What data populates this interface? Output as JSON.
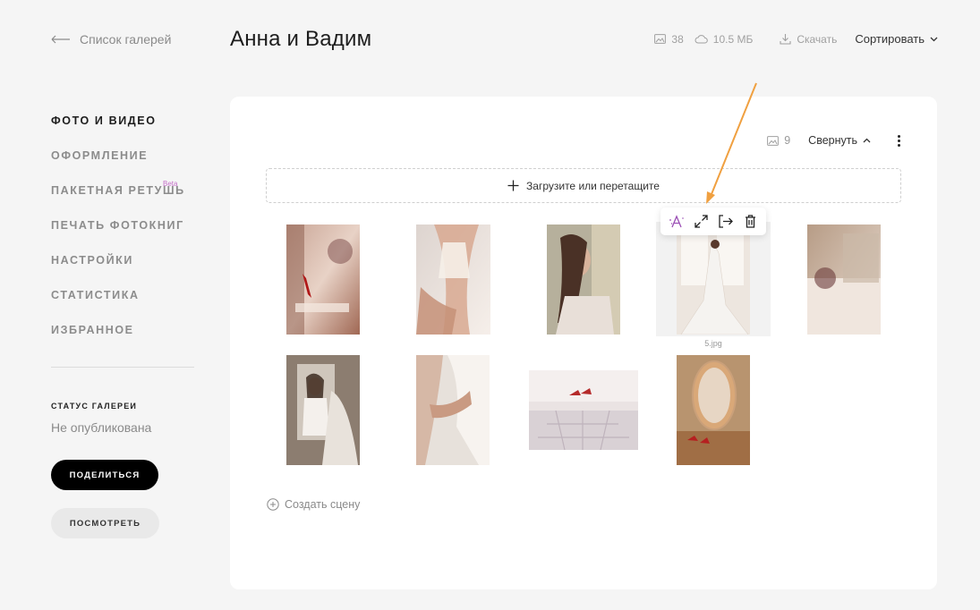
{
  "header": {
    "back_label": "Список галерей",
    "title": "Анна и Вадим",
    "photo_count": "38",
    "size": "10.5 МБ",
    "download_label": "Скачать",
    "sort_label": "Сортировать"
  },
  "sidebar": {
    "items": [
      {
        "label": "ФОТО И ВИДЕО",
        "active": true
      },
      {
        "label": "ОФОРМЛЕНИЕ",
        "active": false
      },
      {
        "label": "ПАКЕТНАЯ РЕТУШЬ",
        "active": false,
        "badge": "Beta"
      },
      {
        "label": "ПЕЧАТЬ ФОТОКНИГ",
        "active": false
      },
      {
        "label": "НАСТРОЙКИ",
        "active": false
      },
      {
        "label": "СТАТИСТИКА",
        "active": false
      },
      {
        "label": "ИЗБРАННОЕ",
        "active": false
      }
    ],
    "status_label": "СТАТУС ГАЛЕРЕИ",
    "status_value": "Не опубликована",
    "share_label": "ПОДЕЛИТЬСЯ",
    "view_label": "ПОСМОТРЕТЬ"
  },
  "scene": {
    "photo_count": "9",
    "collapse_label": "Свернуть",
    "upload_label": "Загрузите или перетащите",
    "selected_filename": "5.jpg",
    "create_scene_label": "Создать сцену"
  },
  "colors": {
    "accent_purple": "#c56fc9",
    "annotation_arrow": "#f0a040",
    "primary_button": "#000000"
  },
  "icons": [
    "arrow-left-icon",
    "image-icon",
    "cloud-icon",
    "download-icon",
    "chevron-down-icon",
    "chevron-up-icon",
    "more-vertical-icon",
    "plus-icon",
    "retouch-icon",
    "expand-icon",
    "move-icon",
    "trash-icon",
    "plus-circle-icon"
  ]
}
